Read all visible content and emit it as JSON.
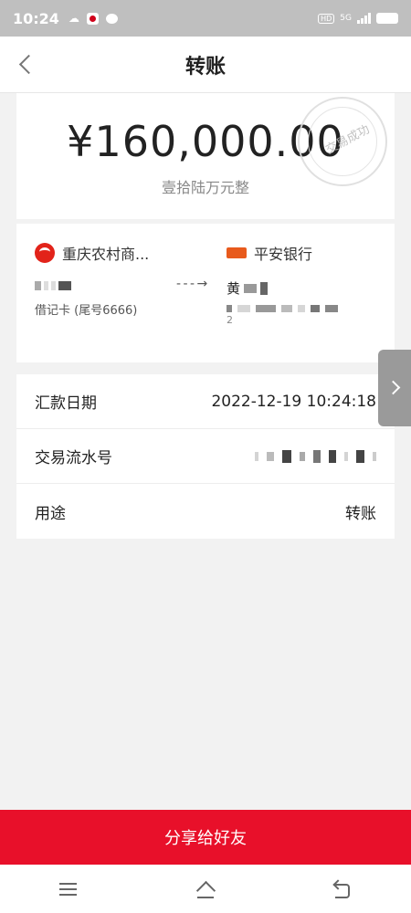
{
  "status_bar": {
    "time": "10:24",
    "network": "5G",
    "hd": "HD"
  },
  "header": {
    "title": "转账"
  },
  "amount": {
    "value": "¥160,000.00",
    "chinese": "壹拾陆万元整",
    "stamp_text": "交易成功"
  },
  "payer": {
    "bank": "重庆农村商...",
    "card_type": "借记卡 (尾号6666)"
  },
  "payee": {
    "bank": "平安银行",
    "name_prefix": "黄",
    "account_tail": "2"
  },
  "transfer_arrow": "- - - →",
  "details": [
    {
      "label": "汇款日期",
      "value": "2022-12-19 10:24:18"
    },
    {
      "label": "交易流水号",
      "value": ""
    },
    {
      "label": "用途",
      "value": "转账"
    }
  ],
  "share_button": "分享给好友",
  "icons": {
    "back": "chevron-left-icon",
    "side": "chevron-right-icon",
    "menu": "menu-icon",
    "home": "home-icon",
    "return": "return-icon"
  },
  "colors": {
    "primary_red": "#e8102a",
    "cq_bank": "#e2231a",
    "pa_bank": "#e85a1c"
  }
}
